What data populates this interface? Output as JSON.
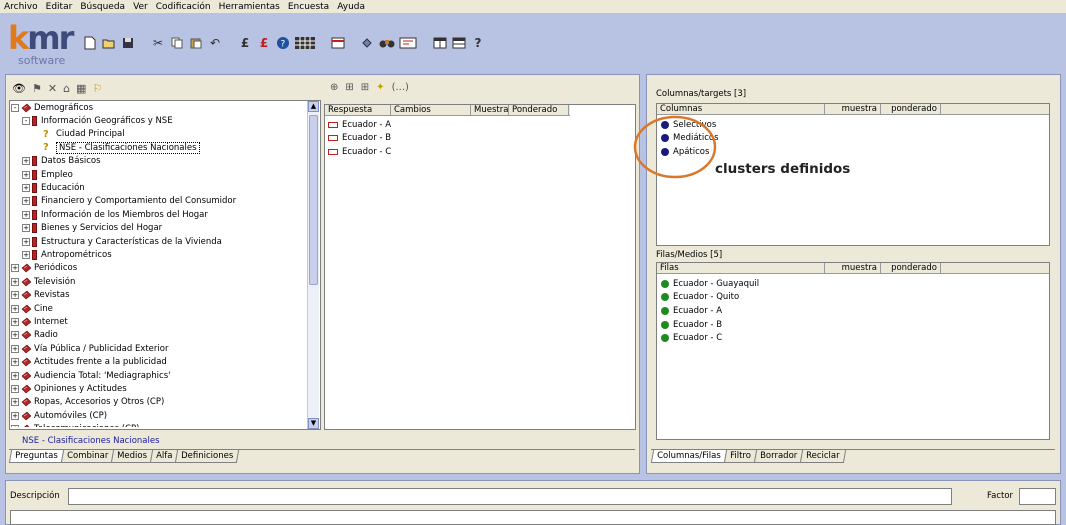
{
  "menu": [
    "Archivo",
    "Editar",
    "Búsqueda",
    "Ver",
    "Codificación",
    "Herramientas",
    "Encuesta",
    "Ayuda"
  ],
  "logo": {
    "brand": "kmr",
    "sub": "software"
  },
  "toolbar_icons": [
    "new-icon",
    "open-icon",
    "save-icon",
    "cut-icon",
    "copy-icon",
    "paste-icon",
    "undo-icon",
    "dollar-icon",
    "dollar-red-icon",
    "help-icon",
    "grid-icon",
    "calendar-icon",
    "link-icon",
    "edit-icon",
    "window-icon",
    "window2-icon",
    "question-icon"
  ],
  "tree": {
    "items": [
      {
        "level": 0,
        "exp": "-",
        "icon": "book",
        "label": "Demográficos"
      },
      {
        "level": 1,
        "exp": "-",
        "icon": "red",
        "label": "Información Geográficos y NSE"
      },
      {
        "level": 2,
        "exp": "",
        "icon": "q",
        "label": "Ciudad Principal"
      },
      {
        "level": 2,
        "exp": "",
        "icon": "q",
        "label": "NSE - Clasificaciones Nacionales",
        "selected": true
      },
      {
        "level": 1,
        "exp": "+",
        "icon": "red",
        "label": "Datos Básicos"
      },
      {
        "level": 1,
        "exp": "+",
        "icon": "red",
        "label": "Empleo"
      },
      {
        "level": 1,
        "exp": "+",
        "icon": "red",
        "label": "Educación"
      },
      {
        "level": 1,
        "exp": "+",
        "icon": "red",
        "label": "Financiero y Comportamiento del Consumidor"
      },
      {
        "level": 1,
        "exp": "+",
        "icon": "red",
        "label": "Información de los Miembros del Hogar"
      },
      {
        "level": 1,
        "exp": "+",
        "icon": "red",
        "label": "Bienes y Servicios del Hogar"
      },
      {
        "level": 1,
        "exp": "+",
        "icon": "red",
        "label": "Estructura y Características de la Vivienda"
      },
      {
        "level": 1,
        "exp": "+",
        "icon": "red",
        "label": "Antropométricos"
      },
      {
        "level": 0,
        "exp": "+",
        "icon": "book",
        "label": "Periódicos"
      },
      {
        "level": 0,
        "exp": "+",
        "icon": "book",
        "label": "Televisión"
      },
      {
        "level": 0,
        "exp": "+",
        "icon": "book",
        "label": "Revistas"
      },
      {
        "level": 0,
        "exp": "+",
        "icon": "book",
        "label": "Cine"
      },
      {
        "level": 0,
        "exp": "+",
        "icon": "book",
        "label": "Internet"
      },
      {
        "level": 0,
        "exp": "+",
        "icon": "book",
        "label": "Radio"
      },
      {
        "level": 0,
        "exp": "+",
        "icon": "book",
        "label": "Vía Pública / Publicidad Exterior"
      },
      {
        "level": 0,
        "exp": "+",
        "icon": "book",
        "label": "Actitudes frente a la publicidad"
      },
      {
        "level": 0,
        "exp": "+",
        "icon": "book",
        "label": "Audiencia Total: 'Mediagraphics'"
      },
      {
        "level": 0,
        "exp": "+",
        "icon": "book",
        "label": "Opiniones y Actitudes"
      },
      {
        "level": 0,
        "exp": "+",
        "icon": "book",
        "label": "Ropas, Accesorios y Otros (CP)"
      },
      {
        "level": 0,
        "exp": "+",
        "icon": "book",
        "label": "Automóviles (CP)"
      },
      {
        "level": 0,
        "exp": "+",
        "icon": "book",
        "label": "Telecomunicaciones (CP)"
      }
    ]
  },
  "status_selected": "NSE - Clasificaciones Nacionales",
  "left_tabs": [
    "Preguntas",
    "Combinar",
    "Medios",
    "Alfa",
    "Definiciones"
  ],
  "middle": {
    "columns": [
      "Respuesta",
      "Cambios",
      "Muestra",
      "Ponderado"
    ],
    "rows": [
      "Ecuador - A",
      "Ecuador - B",
      "Ecuador - C"
    ],
    "toolbar_icons": [
      "add-col-icon",
      "add-row-icon",
      "add-filter-icon",
      "add-medium-icon",
      "parens-icon"
    ],
    "toolbar_last": "(...)"
  },
  "columnas": {
    "title": "Columnas/targets [3]",
    "headers": [
      "Columnas",
      "muestra",
      "ponderado"
    ],
    "items": [
      "Selectivos",
      "Mediáticos",
      "Apáticos"
    ],
    "annotation": "clusters definidos",
    "dot_color": "#1a1a7a"
  },
  "filas": {
    "title": "Filas/Medios [5]",
    "headers": [
      "Filas",
      "muestra",
      "ponderado"
    ],
    "items": [
      "Ecuador - Guayaquil",
      "Ecuador - Quito",
      "Ecuador - A",
      "Ecuador - B",
      "Ecuador - C"
    ],
    "dot_color": "#1f8a1f"
  },
  "right_tabs": [
    "Columnas/Filas",
    "Filtro",
    "Borrador",
    "Reciclar"
  ],
  "bottom": {
    "desc_label": "Descripción",
    "factor_label": "Factor"
  },
  "colors": {
    "accent_orange": "#d9782a",
    "selection": "#0a246a",
    "status_text": "#1a1aa0"
  }
}
